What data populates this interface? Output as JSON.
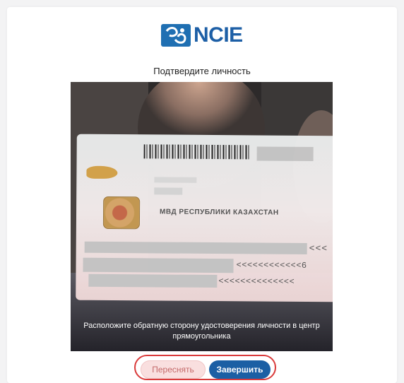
{
  "logo": {
    "text": "NCIE",
    "icon": "ncie-logo-icon"
  },
  "title": "Подтвердите личность",
  "camera": {
    "card_issuer": "МВД РЕСПУБЛИКИ КАЗАХСТАН",
    "mrz_line_1_tail": "<<<",
    "mrz_line_2_tail": "<<<<<<<<<<<<6",
    "mrz_line_3_tail": "<<<<<<<<<<<<<<",
    "hint": "Расположите обратную сторону удостоверения личности в центр прямоугольника"
  },
  "buttons": {
    "retake_label": "Переснять",
    "finish_label": "Завершить"
  },
  "colors": {
    "brand": "#1d5fa6",
    "finish_button": "#1b5fa4",
    "retake_button": "#f9dfdf",
    "highlight_frame": "#d93a3a"
  }
}
